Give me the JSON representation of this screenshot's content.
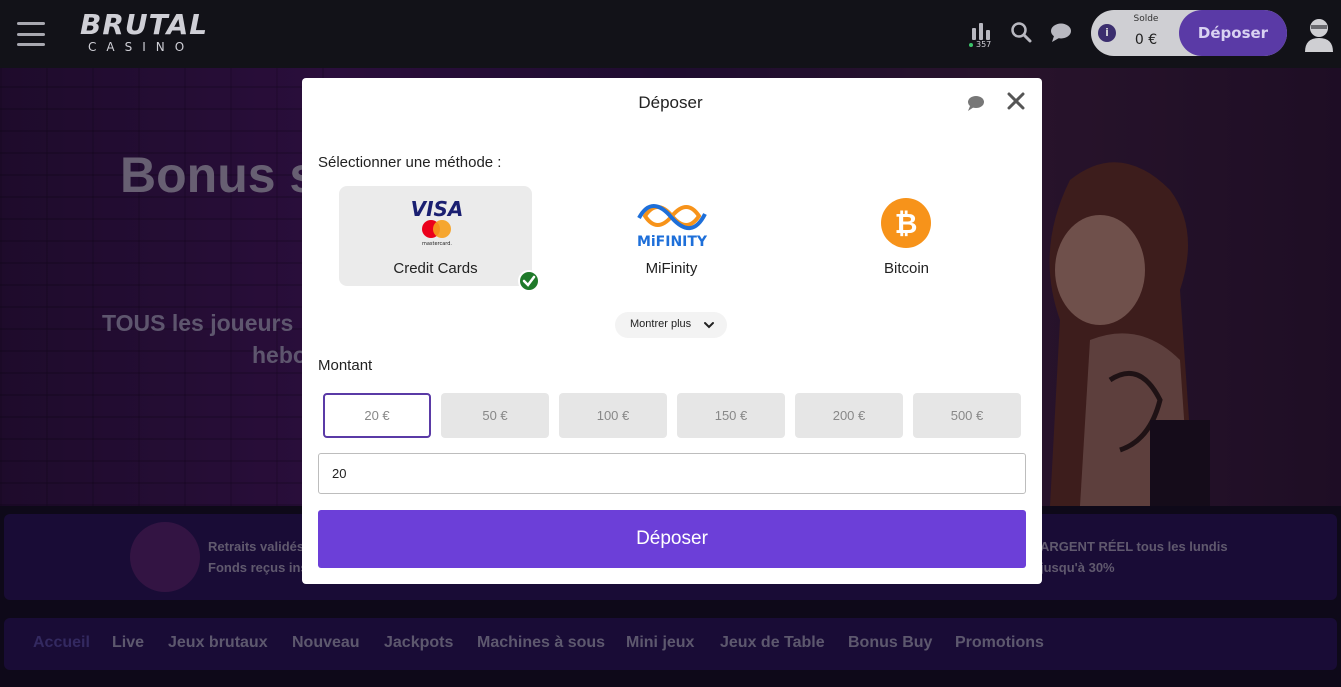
{
  "header": {
    "logo_top": "BRUTAL",
    "logo_bottom": "CASINO",
    "stats_count": "357",
    "balance_label": "Solde",
    "balance_value": "0 €",
    "deposit_label": "Déposer"
  },
  "hero": {
    "title": "Bonus s",
    "subtitle_line1": "TOUS les joueurs",
    "subtitle_line2": "hebo"
  },
  "band": {
    "left_line1": "Retraits validés",
    "left_line2": "Fonds reçus inst",
    "right_line1": "ARGENT RÉEL tous les lundis",
    "right_line2": "jusqu'à 30%"
  },
  "nav": {
    "items": [
      "Accueil",
      "Live",
      "Jeux brutaux",
      "Nouveau",
      "Jackpots",
      "Machines à sous",
      "Mini jeux",
      "Jeux de Table",
      "Bonus Buy",
      "Promotions"
    ]
  },
  "modal": {
    "title": "Déposer",
    "select_method_label": "Sélectionner une méthode :",
    "methods": [
      {
        "name": "Credit Cards",
        "logo_text": "VISA",
        "logo_sub": "mastercard.",
        "selected": true
      },
      {
        "name": "MiFinity",
        "logo_text": "MiFINITY",
        "selected": false
      },
      {
        "name": "Bitcoin",
        "logo_text": "₿",
        "selected": false
      }
    ],
    "show_more_label": "Montrer plus",
    "amount_label": "Montant",
    "amounts": [
      "20 €",
      "50 €",
      "100 €",
      "150 €",
      "200 €",
      "500 €"
    ],
    "selected_amount_index": 0,
    "amount_input_value": "20",
    "submit_label": "Déposer"
  },
  "colors": {
    "accent": "#6c3fd8",
    "header_deposit": "#5a3aa6",
    "check_green": "#1f7a2a",
    "bitcoin_orange": "#f7931a",
    "mifinity_blue": "#1e6fd9"
  }
}
